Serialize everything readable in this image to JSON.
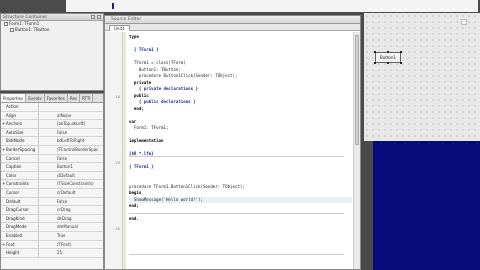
{
  "structure": {
    "title": "Structure Container",
    "tree": [
      "Form1: TForm1",
      "Button1: TButton"
    ]
  },
  "inspector": {
    "tabs": [
      "Properties",
      "Events",
      "Favorites",
      "Res",
      "RTTI"
    ],
    "rows": [
      {
        "name": "Action",
        "value": ""
      },
      {
        "name": "Align",
        "value": "alNone"
      },
      {
        "name": "Anchors",
        "value": "[akTop,akLeft]"
      },
      {
        "name": "AutoSize",
        "value": "False"
      },
      {
        "name": "BidiMode",
        "value": "bdLeftToRight"
      },
      {
        "name": "BorderSpacing",
        "value": "(TControlBorderSpac"
      },
      {
        "name": "Cancel",
        "value": "False"
      },
      {
        "name": "Caption",
        "value": "Button1"
      },
      {
        "name": "Color",
        "value": "clDefault"
      },
      {
        "name": "Constraints",
        "value": "(TSizeConstraints)"
      },
      {
        "name": "Cursor",
        "value": "crDefault"
      },
      {
        "name": "Default",
        "value": "False"
      },
      {
        "name": "DragCursor",
        "value": "crDrag"
      },
      {
        "name": "DragKind",
        "value": "dkDrag"
      },
      {
        "name": "DragMode",
        "value": "dmManual"
      },
      {
        "name": "Enabled",
        "value": "True"
      },
      {
        "name": "Font",
        "value": "(TFont)"
      },
      {
        "name": "Height",
        "value": "25"
      }
    ]
  },
  "editor": {
    "title": "Source Editor",
    "tab": "Unit1",
    "lines": [
      {
        "text": "type",
        "style": "kw"
      },
      {
        "text": "",
        "style": ""
      },
      {
        "text": "  { TForm1 }",
        "style": "cm"
      },
      {
        "text": "",
        "style": ""
      },
      {
        "text": "  TForm1 = class(TForm)",
        "style": ""
      },
      {
        "text": "    Button1: TButton;",
        "style": ""
      },
      {
        "text": "    procedure Button1Click(Sender: TObject);",
        "style": ""
      },
      {
        "text": "  private",
        "style": "kw"
      },
      {
        "text": "    { private declarations }",
        "style": "cm"
      },
      {
        "text": "  public",
        "style": "kw"
      },
      {
        "text": "    { public declarations }",
        "style": "cm"
      },
      {
        "text": "  end;",
        "style": "kw"
      },
      {
        "text": "",
        "style": ""
      },
      {
        "text": "var",
        "style": "kw"
      },
      {
        "text": "  Form1: TForm1;",
        "style": ""
      },
      {
        "text": "",
        "style": ""
      },
      {
        "text": "implementation",
        "style": "kw"
      },
      {
        "text": "",
        "style": ""
      },
      {
        "text": "{$R *.lfm}",
        "style": "cm"
      },
      {
        "text": "",
        "style": ""
      },
      {
        "text": "{ TForm1 }",
        "style": "cm"
      },
      {
        "text": "",
        "style": ""
      },
      {
        "text": "",
        "style": ""
      },
      {
        "text": "procedure TForm1.Button1Click(Sender: TObject);",
        "style": ""
      },
      {
        "text": "begin",
        "style": "kw"
      },
      {
        "text": "  ShowMessage('Hello world!');",
        "style": "cur"
      },
      {
        "text": "end;",
        "style": "kw"
      },
      {
        "text": "",
        "style": ""
      },
      {
        "text": "end.",
        "style": "kw"
      }
    ],
    "line_numbers": [
      "10",
      "20",
      "30"
    ]
  },
  "form_designer": {
    "button_caption": "Button1"
  },
  "colors": {
    "background": "#4a4a4a",
    "blue_region": "#070c7c",
    "current_line": "#e7eefc"
  }
}
